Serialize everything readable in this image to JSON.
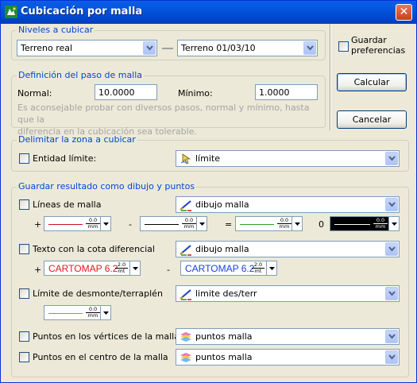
{
  "window": {
    "title": "Cubicación por malla",
    "close_glyph": "✕"
  },
  "niveles": {
    "legend": "Niveles a cubicar",
    "level1": "Terreno real",
    "level2": "Terreno 01/03/10"
  },
  "malla": {
    "legend": "Definición del paso de malla",
    "normal_label": "Normal:",
    "normal_value": "10.0000",
    "minimo_label": "Mínimo:",
    "minimo_value": "1.0000",
    "hint_line1": "Es aconsejable probar con diversos pasos, normal y mínimo, hasta que la",
    "hint_line2": "diferencia en la cubicación sea tolerable."
  },
  "side": {
    "guardar_pref_line1": "Guardar",
    "guardar_pref_line2": "preferencias",
    "calcular": "Calcular",
    "cancelar": "Cancelar"
  },
  "zona": {
    "legend": "Delimitar la zona a cubicar",
    "entidad_label": "Entidad límite:",
    "entidad_value": "límite",
    "entidad_icon": "pointer-select-icon"
  },
  "resultado": {
    "legend": "Guardar resultado como dibujo y puntos",
    "lineas_label": "Líneas de malla",
    "lineas_layer": "dibujo malla",
    "op_plus": "+",
    "op_minus": "-",
    "op_equals": "=",
    "op_zero": "0",
    "width_value": "0.0",
    "width_unit": "mm",
    "text_width_value": "2.0",
    "text_width_unit": "mt",
    "texto_label": "Texto con la cota diferencial",
    "texto_layer": "dibujo malla",
    "text_style_sample": "CARTOMAP 6.2",
    "limite_label": "Límite de desmonte/terraplén",
    "limite_layer": "limite des/terr",
    "vertices_label": "Puntos en los vértices de la malla",
    "vertices_layer": "puntos malla",
    "centro_label": "Puntos en el centro de la malla",
    "centro_layer": "puntos malla",
    "layer_icon": "layer-pen-icon",
    "points_icon": "points-layer-icon"
  },
  "colors": {
    "line_red": "#c8102e",
    "line_black": "#000000",
    "line_green": "#2aa02a",
    "line_orange": "#e87b00",
    "text_red": "#e8141c",
    "text_blue": "#1a3ee0"
  }
}
